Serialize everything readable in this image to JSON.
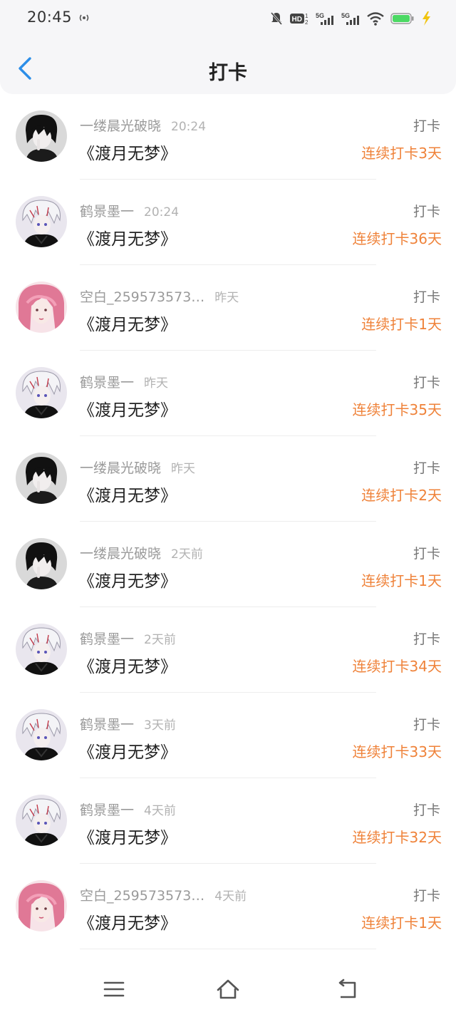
{
  "status_bar": {
    "time": "20:45",
    "icons": [
      "hotspot-icon",
      "mute-bell-icon",
      "hd-icon",
      "signal-5g-icon",
      "signal-5g-icon",
      "wifi-icon",
      "battery-icon",
      "charging-icon"
    ],
    "battery_color": "#4cd964"
  },
  "header": {
    "title": "打卡",
    "back_icon": "chevron-left-icon",
    "accent": "#2c8ee8"
  },
  "colors": {
    "streak": "#ef8239"
  },
  "items": [
    {
      "user": "一缕晨光破晓",
      "time": "20:24",
      "book": "《渡月无梦》",
      "action": "打卡",
      "streak": "连续打卡3天",
      "avatar": "dark-haired-avatar"
    },
    {
      "user": "鹤景墨一",
      "time": "20:24",
      "book": "《渡月无梦》",
      "action": "打卡",
      "streak": "连续打卡36天",
      "avatar": "white-haired-avatar"
    },
    {
      "user": "空白_259573573…",
      "time": "昨天",
      "book": "《渡月无梦》",
      "action": "打卡",
      "streak": "连续打卡1天",
      "avatar": "pink-haired-avatar"
    },
    {
      "user": "鹤景墨一",
      "time": "昨天",
      "book": "《渡月无梦》",
      "action": "打卡",
      "streak": "连续打卡35天",
      "avatar": "white-haired-avatar"
    },
    {
      "user": "一缕晨光破晓",
      "time": "昨天",
      "book": "《渡月无梦》",
      "action": "打卡",
      "streak": "连续打卡2天",
      "avatar": "dark-haired-avatar"
    },
    {
      "user": "一缕晨光破晓",
      "time": "2天前",
      "book": "《渡月无梦》",
      "action": "打卡",
      "streak": "连续打卡1天",
      "avatar": "dark-haired-avatar"
    },
    {
      "user": "鹤景墨一",
      "time": "2天前",
      "book": "《渡月无梦》",
      "action": "打卡",
      "streak": "连续打卡34天",
      "avatar": "white-haired-avatar"
    },
    {
      "user": "鹤景墨一",
      "time": "3天前",
      "book": "《渡月无梦》",
      "action": "打卡",
      "streak": "连续打卡33天",
      "avatar": "white-haired-avatar"
    },
    {
      "user": "鹤景墨一",
      "time": "4天前",
      "book": "《渡月无梦》",
      "action": "打卡",
      "streak": "连续打卡32天",
      "avatar": "white-haired-avatar"
    },
    {
      "user": "空白_259573573…",
      "time": "4天前",
      "book": "《渡月无梦》",
      "action": "打卡",
      "streak": "连续打卡1天",
      "avatar": "pink-haired-avatar"
    }
  ],
  "nav_bar": {
    "buttons": [
      "menu-icon",
      "home-icon",
      "back-icon"
    ]
  }
}
